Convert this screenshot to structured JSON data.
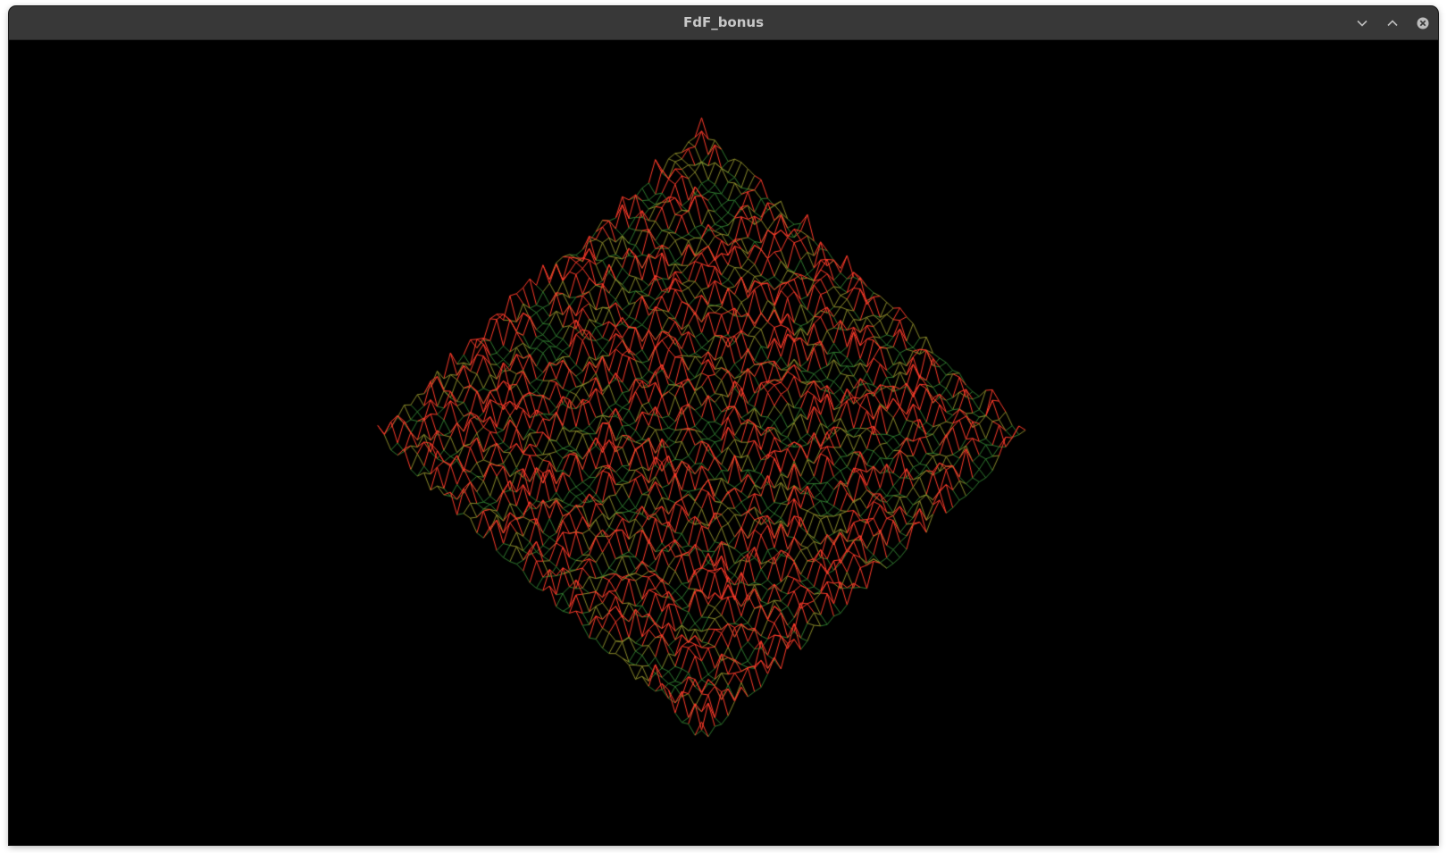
{
  "window": {
    "title": "FdF_bonus",
    "controls": {
      "minimize_icon": "chevron-down-icon",
      "maximize_icon": "chevron-up-icon",
      "close_icon": "close-circle-icon"
    }
  },
  "viewport": {
    "background": "#000000",
    "colors": {
      "low": "#2f7a2f",
      "mid": "#8a8a2a",
      "high": "#ff3b2a"
    }
  }
}
